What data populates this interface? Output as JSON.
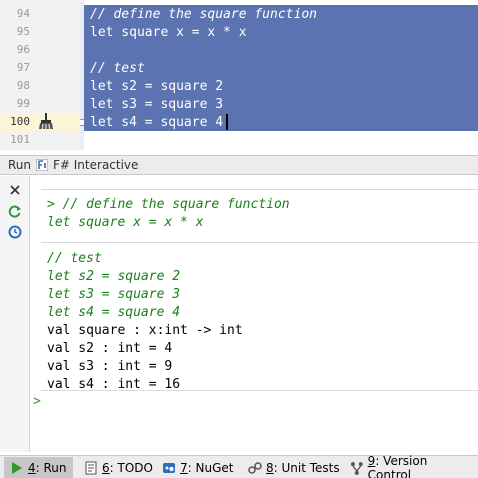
{
  "editor": {
    "line_numbers": [
      "94",
      "95",
      "96",
      "97",
      "98",
      "99",
      "100",
      "101"
    ],
    "current_line": "100",
    "lines": [
      "// define the square function",
      "let square x = x * x",
      "",
      "// test",
      "let s2 = square 2",
      "let s3 = square 3",
      "let s4 = square 4"
    ]
  },
  "tool_window": {
    "run_label": "Run",
    "tab_label": "F# Interactive",
    "toolbar_icons": [
      "close-icon",
      "rerun-icon",
      "reset-icon"
    ]
  },
  "console": {
    "echo_lines": [
      "> // define the square function",
      "let square x = x * x",
      "// test",
      "let s2 = square 2",
      "let s3 = square 3",
      "let s4 = square 4"
    ],
    "output_lines": [
      "val square : x:int -> int",
      "val s2 : int = 4",
      "val s3 : int = 9",
      "val s4 : int = 16"
    ],
    "prompt": ">"
  },
  "bottom_bar": {
    "tabs": [
      {
        "num": "4",
        "label": ": Run",
        "icon": "run-icon",
        "active": true
      },
      {
        "num": "6",
        "label": ": TODO",
        "icon": "todo-icon",
        "active": false
      },
      {
        "num": "7",
        "label": ": NuGet",
        "icon": "nuget-icon",
        "active": false
      },
      {
        "num": "8",
        "label": ": Unit Tests",
        "icon": "unit-tests-icon",
        "active": false
      },
      {
        "num": "9",
        "label": ": Version Control",
        "icon": "version-control-icon",
        "active": false
      }
    ]
  },
  "colors": {
    "selection": "#5b73b0",
    "fsi_green": "#198019",
    "prompt_green": "#2f9a2f"
  }
}
